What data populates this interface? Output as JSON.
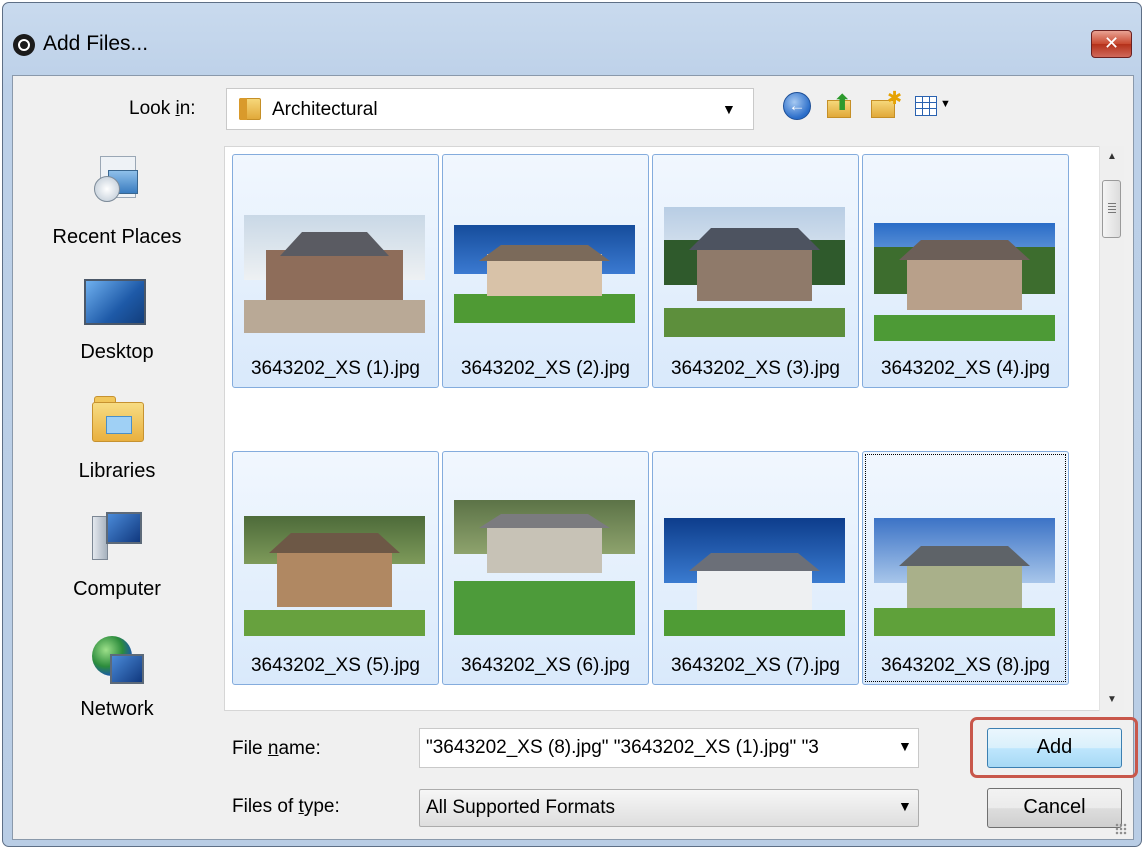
{
  "window": {
    "title": "Add Files...",
    "close_label": "✕"
  },
  "look_in": {
    "label_before": "Look ",
    "label_underlined": "i",
    "label_after": "n:",
    "value": "Architectural",
    "arrow": "▼"
  },
  "toolbar": {
    "back_glyph": "←",
    "up_glyph": "⬆",
    "new_folder_glyph": "✱",
    "views_arrow": "▼",
    "icons": [
      "back-icon",
      "up-folder-icon",
      "new-folder-icon",
      "views-menu-icon"
    ]
  },
  "places": [
    {
      "label": "Recent Places",
      "icon": "recent-places-icon"
    },
    {
      "label": "Desktop",
      "icon": "desktop-icon"
    },
    {
      "label": "Libraries",
      "icon": "libraries-icon"
    },
    {
      "label": "Computer",
      "icon": "computer-icon"
    },
    {
      "label": "Network",
      "icon": "network-icon"
    }
  ],
  "files": [
    {
      "name": "3643202_XS (1).jpg",
      "selected": true
    },
    {
      "name": "3643202_XS (2).jpg",
      "selected": true
    },
    {
      "name": "3643202_XS (3).jpg",
      "selected": true
    },
    {
      "name": "3643202_XS (4).jpg",
      "selected": true
    },
    {
      "name": "3643202_XS (5).jpg",
      "selected": true
    },
    {
      "name": "3643202_XS (6).jpg",
      "selected": true
    },
    {
      "name": "3643202_XS (7).jpg",
      "selected": true
    },
    {
      "name": "3643202_XS (8).jpg",
      "selected": true,
      "focused": true
    }
  ],
  "scrollbar": {
    "up_arrow": "▲",
    "down_arrow": "▼"
  },
  "file_name": {
    "label_before": "File ",
    "label_underlined": "n",
    "label_after": "ame:",
    "value": "\"3643202_XS (8).jpg\" \"3643202_XS (1).jpg\" \"3",
    "arrow": "▼"
  },
  "file_type": {
    "label_before": "Files of ",
    "label_underlined": "t",
    "label_after": "ype:",
    "value": "All Supported Formats",
    "arrow": "▼"
  },
  "buttons": {
    "add": "Add",
    "cancel": "Cancel"
  },
  "colors": {
    "selection_border": "#84acdd",
    "highlight_frame": "#c8574b",
    "primary_button_border": "#3c7fb1"
  }
}
